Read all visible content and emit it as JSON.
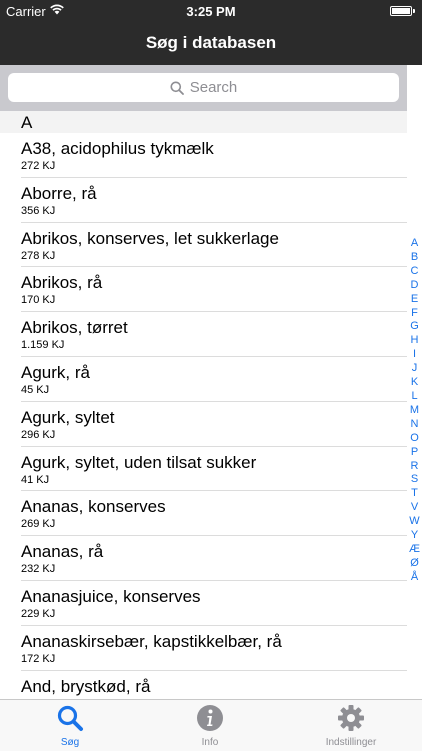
{
  "status_bar": {
    "carrier": "Carrier",
    "time": "3:25 PM"
  },
  "nav": {
    "title": "Søg i databasen"
  },
  "search": {
    "placeholder": "Search"
  },
  "section_header": "A",
  "items": [
    {
      "name": "A38, acidophilus tykmælk",
      "kj": "272 KJ"
    },
    {
      "name": "Aborre, rå",
      "kj": "356 KJ"
    },
    {
      "name": "Abrikos, konserves, let sukkerlage",
      "kj": "278 KJ"
    },
    {
      "name": "Abrikos, rå",
      "kj": "170 KJ"
    },
    {
      "name": "Abrikos, tørret",
      "kj": "1.159 KJ"
    },
    {
      "name": "Agurk, rå",
      "kj": "45 KJ"
    },
    {
      "name": "Agurk, syltet",
      "kj": "296 KJ"
    },
    {
      "name": "Agurk, syltet, uden tilsat sukker",
      "kj": "41 KJ"
    },
    {
      "name": "Ananas, konserves",
      "kj": "269 KJ"
    },
    {
      "name": "Ananas, rå",
      "kj": "232 KJ"
    },
    {
      "name": "Ananasjuice, konserves",
      "kj": "229 KJ"
    },
    {
      "name": "Ananaskirsebær, kapstikkelbær, rå",
      "kj": "172 KJ"
    },
    {
      "name": "And, brystkød, rå",
      "kj": ""
    }
  ],
  "index_letters": [
    "A",
    "B",
    "C",
    "D",
    "E",
    "F",
    "G",
    "H",
    "I",
    "J",
    "K",
    "L",
    "M",
    "N",
    "O",
    "P",
    "R",
    "S",
    "T",
    "V",
    "W",
    "Y",
    "Æ",
    "Ø",
    "Å"
  ],
  "tabs": [
    {
      "label": "Søg",
      "icon": "search-icon"
    },
    {
      "label": "Info",
      "icon": "info-icon"
    },
    {
      "label": "Indstillinger",
      "icon": "gear-icon"
    }
  ],
  "colors": {
    "accent": "#1a73e8",
    "nav_bg": "#2b2b2b",
    "search_bar_bg": "#c9c9ce"
  }
}
